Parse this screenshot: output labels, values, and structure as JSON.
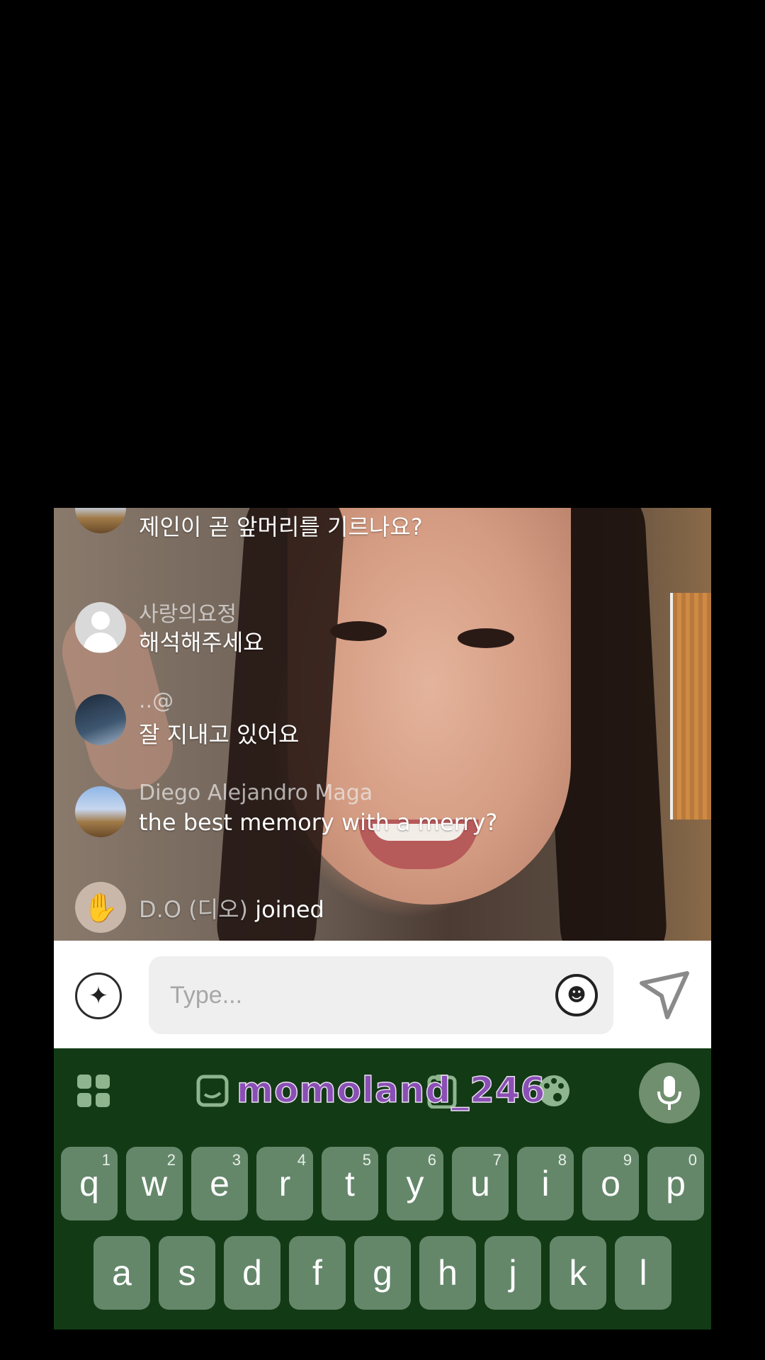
{
  "chat": {
    "messages": [
      {
        "username": "",
        "text": "제인이 곧 앞머리를 기르나요?"
      },
      {
        "username": "사랑의요정",
        "text": "해석해주세요"
      },
      {
        "username": "..@",
        "text": "잘 지내고 있어요"
      },
      {
        "username": "Diego Alejandro Maga",
        "text": "the best memory with a merry?"
      }
    ],
    "joined": {
      "name": "D.O (디오)",
      "action": "joined"
    }
  },
  "input": {
    "placeholder": "Type..."
  },
  "keyboard": {
    "watermark": "momoland_246",
    "row1": [
      {
        "key": "q",
        "hint": "1"
      },
      {
        "key": "w",
        "hint": "2"
      },
      {
        "key": "e",
        "hint": "3"
      },
      {
        "key": "r",
        "hint": "4"
      },
      {
        "key": "t",
        "hint": "5"
      },
      {
        "key": "y",
        "hint": "6"
      },
      {
        "key": "u",
        "hint": "7"
      },
      {
        "key": "i",
        "hint": "8"
      },
      {
        "key": "o",
        "hint": "9"
      },
      {
        "key": "p",
        "hint": "0"
      }
    ],
    "row2": [
      "a",
      "s",
      "d",
      "f",
      "g",
      "h",
      "j",
      "k",
      "l"
    ]
  },
  "colors": {
    "keyboard_bg": "#123a15",
    "key_bg": "#64876a",
    "input_bg": "#efefef"
  },
  "icons": [
    "ai-sparkle-icon",
    "emoji-icon",
    "send-icon",
    "apps-grid-icon",
    "sticker-icon",
    "clipboard-icon",
    "palette-icon",
    "mic-icon"
  ]
}
